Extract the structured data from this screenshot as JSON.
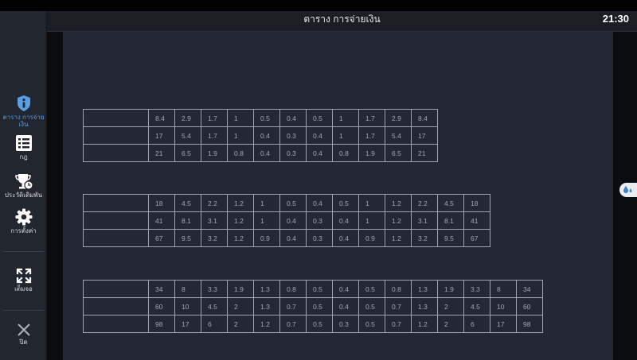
{
  "header": {
    "title": "ตาราง การจ่ายเงิน",
    "clock": "21:30"
  },
  "sidebar": {
    "items": [
      {
        "label": "ตาราง การจ่ายเงิน",
        "icon": "info-icon",
        "active": true
      },
      {
        "label": "กฎ",
        "icon": "list-icon",
        "active": false
      },
      {
        "label": "ประวัติเดิมพัน",
        "icon": "trophy-clock-icon",
        "active": false
      },
      {
        "label": "การตั้งค่า",
        "icon": "gear-icon",
        "active": false
      },
      {
        "label": "เต็มจอ",
        "icon": "fullscreen-icon",
        "active": false
      },
      {
        "label": "ปิด",
        "icon": "close-icon",
        "active": false
      }
    ]
  },
  "colors": {
    "accent": "#5a9fe6",
    "panel": "#232833",
    "sidebar": "#22262f"
  },
  "tables": [
    {
      "rows": [
        [
          "8.4",
          "2.9",
          "1.7",
          "1",
          "0.5",
          "0.4",
          "0.5",
          "1",
          "1.7",
          "2.9",
          "8.4"
        ],
        [
          "17",
          "5.4",
          "1.7",
          "1",
          "0.4",
          "0.3",
          "0.4",
          "1",
          "1.7",
          "5.4",
          "17"
        ],
        [
          "21",
          "6.5",
          "1.9",
          "0.8",
          "0.4",
          "0.3",
          "0.4",
          "0.8",
          "1.9",
          "6.5",
          "21"
        ]
      ]
    },
    {
      "rows": [
        [
          "18",
          "4.5",
          "2.2",
          "1.2",
          "1",
          "0.5",
          "0.4",
          "0.5",
          "1",
          "1.2",
          "2.2",
          "4.5",
          "18"
        ],
        [
          "41",
          "8.1",
          "3.1",
          "1.2",
          "1",
          "0.4",
          "0.3",
          "0.4",
          "1",
          "1.2",
          "3.1",
          "8.1",
          "41"
        ],
        [
          "67",
          "9.5",
          "3.2",
          "1.2",
          "0.9",
          "0.4",
          "0.3",
          "0.4",
          "0.9",
          "1.2",
          "3.2",
          "9.5",
          "67"
        ]
      ]
    },
    {
      "rows": [
        [
          "34",
          "8",
          "3.3",
          "1.9",
          "1.3",
          "0.8",
          "0.5",
          "0.4",
          "0.5",
          "0.8",
          "1.3",
          "1.9",
          "3.3",
          "8",
          "34"
        ],
        [
          "60",
          "10",
          "4.5",
          "2",
          "1.3",
          "0.7",
          "0.5",
          "0.4",
          "0.5",
          "0.7",
          "1.3",
          "2",
          "4.5",
          "10",
          "60"
        ],
        [
          "98",
          "17",
          "6",
          "2",
          "1.2",
          "0.7",
          "0.5",
          "0.3",
          "0.5",
          "0.7",
          "1.2",
          "2",
          "6",
          "17",
          "98"
        ]
      ]
    }
  ]
}
